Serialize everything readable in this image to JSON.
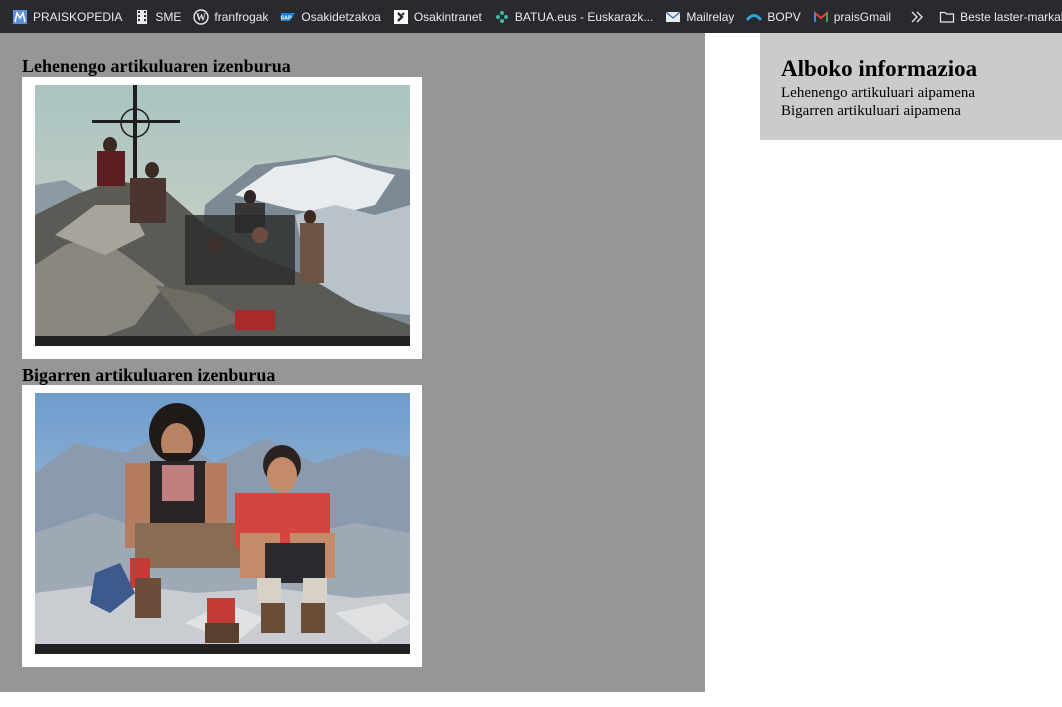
{
  "bookmarks": [
    {
      "label": "PRAISKOPEDIA",
      "icon": "praiskopedia-icon"
    },
    {
      "label": "SME",
      "icon": "film-icon"
    },
    {
      "label": "franfrogak",
      "icon": "wordpress-icon"
    },
    {
      "label": "Osakidetzakoa",
      "icon": "sap-icon"
    },
    {
      "label": "Osakintranet",
      "icon": "osakintranet-icon"
    },
    {
      "label": "BATUA.eus - Euskarazk...",
      "icon": "batua-icon"
    },
    {
      "label": "Mailrelay",
      "icon": "mail-icon"
    },
    {
      "label": "BOPV",
      "icon": "bopv-icon"
    },
    {
      "label": "praisGmail",
      "icon": "gmail-icon"
    }
  ],
  "bookmarks_more": "»",
  "bookmarks_folder": "Beste laster-markak",
  "main": {
    "articles": [
      {
        "title": "Lehenengo artikuluaren izenburua",
        "image": "group-of-mountaineers-on-summit-photo"
      },
      {
        "title": "Bigarren artikuluaren izenburua",
        "image": "two-mountaineers-sitting-photo"
      }
    ]
  },
  "aside": {
    "title": "Alboko informazioa",
    "items": [
      "Lehenengo artikuluari aipamena",
      "Bigarren artikuluari aipamena"
    ]
  },
  "colors": {
    "bookmarks_bg": "#292a2d",
    "main_bg": "#969696",
    "aside_bg": "#cbcbcb"
  }
}
